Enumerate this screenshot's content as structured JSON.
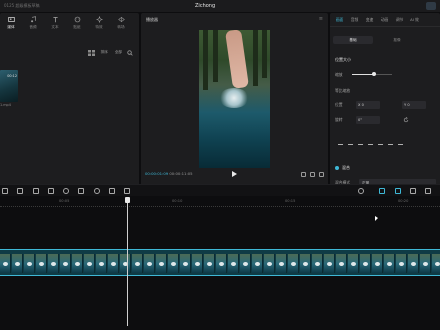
{
  "titlebar": {
    "project_name": "0125 超级模板草稿",
    "app_name": "Zichong"
  },
  "media": {
    "tabs": [
      {
        "label": "媒体",
        "icon": "media-icon"
      },
      {
        "label": "音频",
        "icon": "audio-icon"
      },
      {
        "label": "文本",
        "icon": "text-icon"
      },
      {
        "label": "贴纸",
        "icon": "sticker-icon"
      },
      {
        "label": "特效",
        "icon": "effects-icon"
      },
      {
        "label": "转场",
        "icon": "transition-icon"
      }
    ],
    "toolbar": {
      "sort_label": "排序",
      "filter_label": "全部"
    },
    "clip": {
      "duration": "00:12",
      "name": "1.mp4"
    }
  },
  "player": {
    "title": "播放器",
    "current_time": "00:00:01:09",
    "total_time": "00:00:11:05"
  },
  "inspector": {
    "tabs": [
      "画面",
      "音频",
      "变速",
      "动画",
      "调节",
      "AI 效"
    ],
    "subtabs": [
      "基础",
      "抠像"
    ],
    "section_size": "位置大小",
    "scale_label": "缩放",
    "uniform_label": "等比缩放",
    "position_label": "位置",
    "position_x": "X 0",
    "position_y": "Y 0",
    "rotation_label": "旋转",
    "rotation_value": "0°",
    "blend_section": "混合",
    "blend_mode_label": "混合模式",
    "blend_mode_value": "正常",
    "scale_fraction": 0.55
  },
  "timeline": {
    "ruler": [
      "00:05",
      "00:10",
      "00:15",
      "00:20"
    ]
  },
  "colors": {
    "accent": "#3fb8d6",
    "panel": "#1d1d1f",
    "background": "#0d0d0f"
  }
}
